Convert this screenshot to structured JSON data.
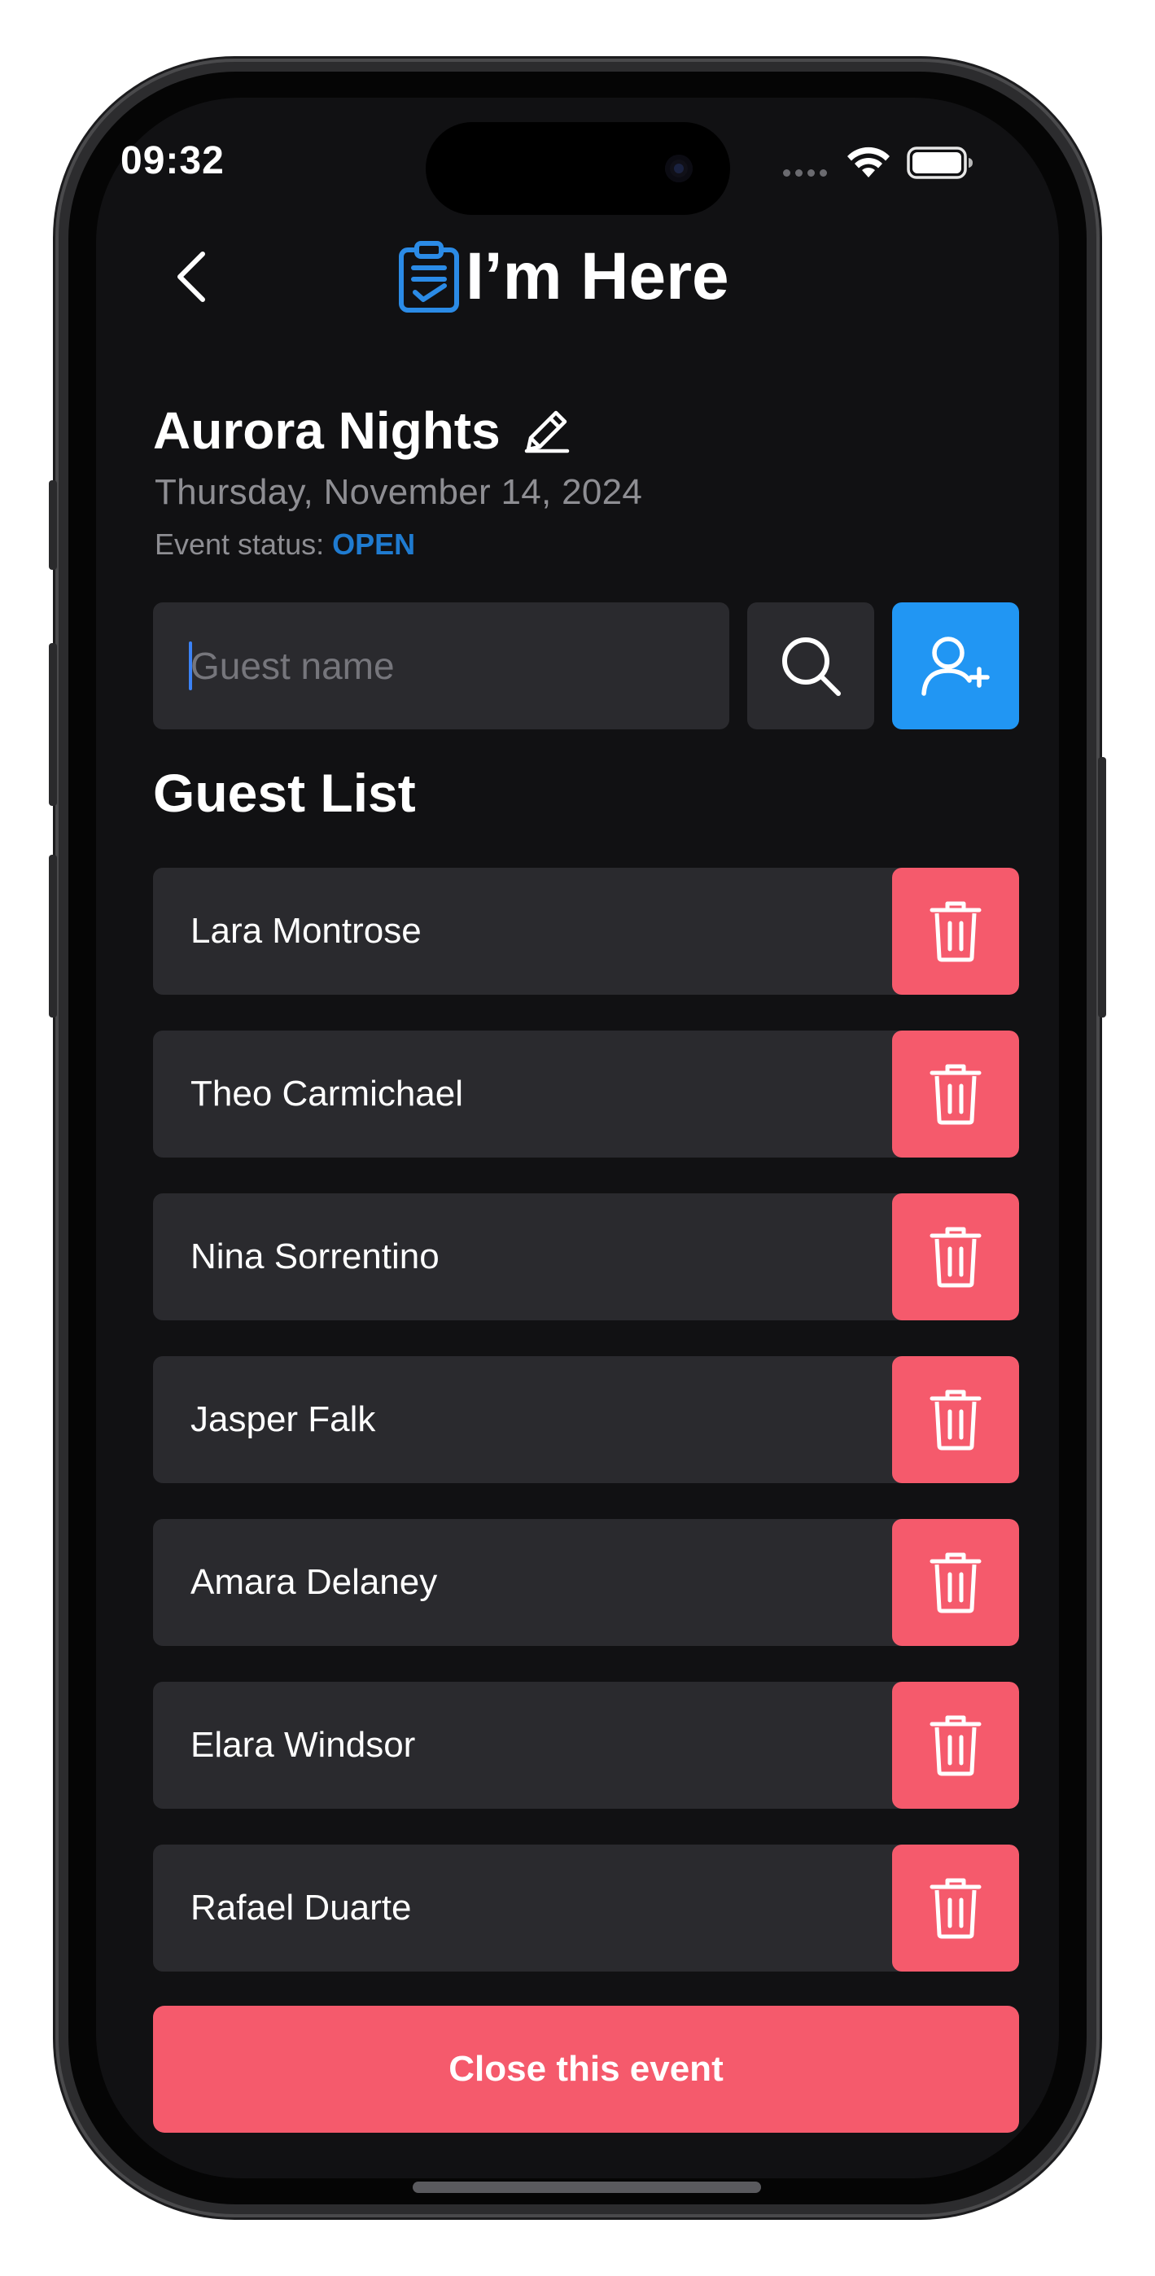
{
  "status_bar": {
    "time": "09:32"
  },
  "header": {
    "title": "I’m Here",
    "back_icon": "chevron-left-icon",
    "logo_icon": "clipboard-check-icon"
  },
  "event": {
    "name": "Aurora Nights",
    "date": "Thursday, November 14, 2024",
    "status_label": "Event status:",
    "status_value": "OPEN"
  },
  "search": {
    "placeholder": "Guest name",
    "search_icon": "search-icon",
    "add_icon": "add-user-icon"
  },
  "guest_list": {
    "title": "Guest List",
    "guests": [
      "Lara Montrose",
      "Theo Carmichael",
      "Nina Sorrentino",
      "Jasper Falk",
      "Amara Delaney",
      "Elara Windsor",
      "Rafael Duarte"
    ]
  },
  "actions": {
    "close_event_label": "Close this event"
  },
  "colors": {
    "background": "#111113",
    "card": "#2a2a2e",
    "accent_blue": "#2196f3",
    "status_blue": "#1f7bd0",
    "danger": "#f55a6c"
  }
}
